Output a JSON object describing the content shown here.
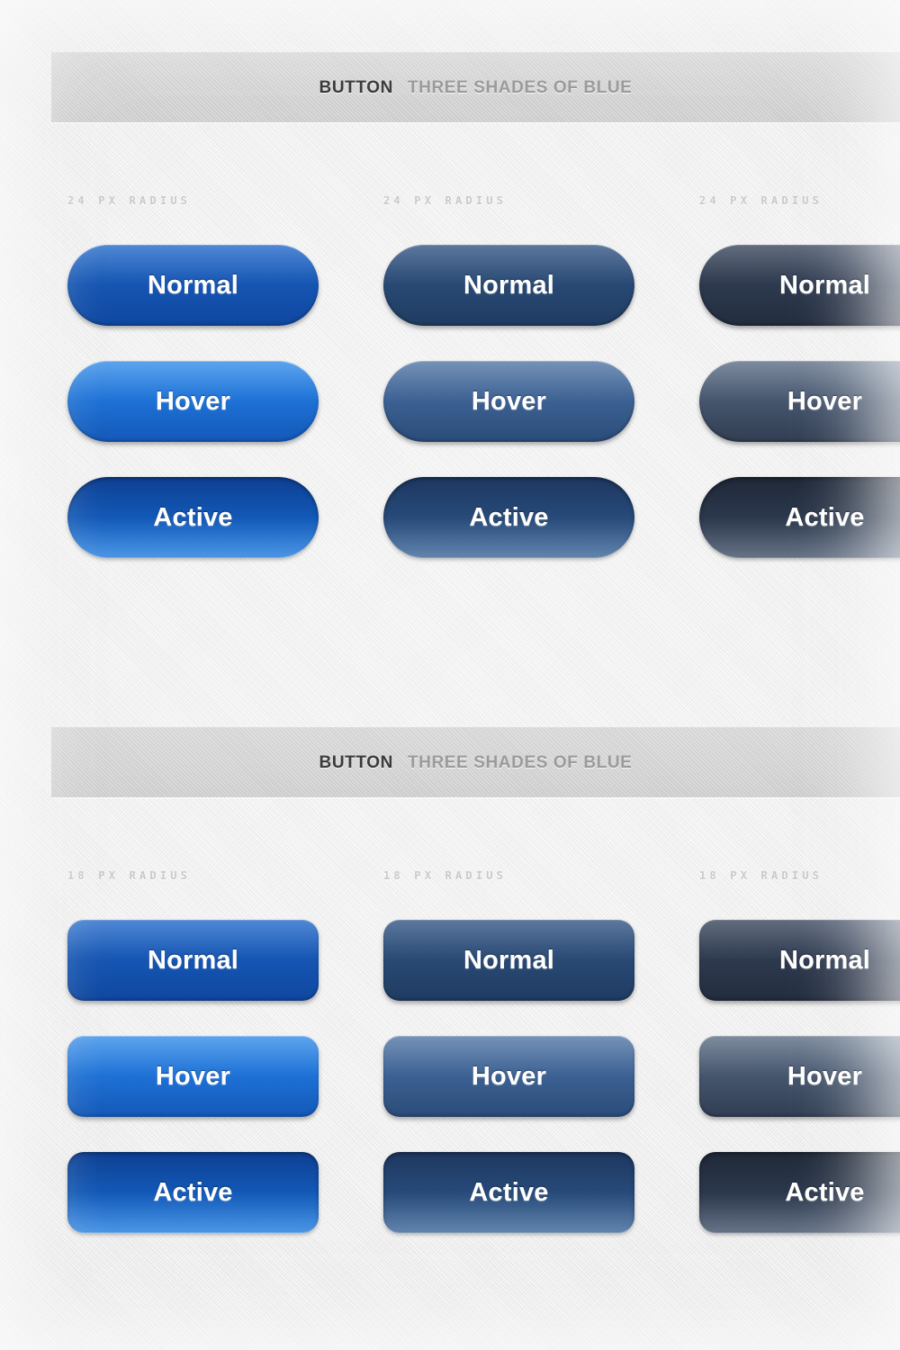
{
  "page": {
    "background_color": "#eeefef",
    "texture": "diagonal-canvas-weave"
  },
  "sections": [
    {
      "id": "section-1",
      "header": {
        "strong": "BUTTON",
        "light": "THREE SHADES OF BLUE"
      },
      "radius_label": "24 PX RADIUS",
      "radius_px": 24,
      "columns": [
        {
          "shade": "vivid-blue",
          "accent": "#1657b5",
          "buttons": [
            {
              "state": "normal",
              "label": "Normal"
            },
            {
              "state": "hover",
              "label": "Hover"
            },
            {
              "state": "active",
              "label": "Active"
            }
          ]
        },
        {
          "shade": "steel-blue",
          "accent": "#294a75",
          "buttons": [
            {
              "state": "normal",
              "label": "Normal"
            },
            {
              "state": "hover",
              "label": "Hover"
            },
            {
              "state": "active",
              "label": "Active"
            }
          ]
        },
        {
          "shade": "slate-navy",
          "accent": "#2e3a4f",
          "buttons": [
            {
              "state": "normal",
              "label": "Normal"
            },
            {
              "state": "hover",
              "label": "Hover"
            },
            {
              "state": "active",
              "label": "Active"
            }
          ]
        }
      ]
    },
    {
      "id": "section-2",
      "header": {
        "strong": "BUTTON",
        "light": "THREE SHADES OF BLUE"
      },
      "radius_label": "18 PX RADIUS",
      "radius_px": 18,
      "columns": [
        {
          "shade": "vivid-blue",
          "accent": "#1657b5",
          "buttons": [
            {
              "state": "normal",
              "label": "Normal"
            },
            {
              "state": "hover",
              "label": "Hover"
            },
            {
              "state": "active",
              "label": "Active"
            }
          ]
        },
        {
          "shade": "steel-blue",
          "accent": "#294a75",
          "buttons": [
            {
              "state": "normal",
              "label": "Normal"
            },
            {
              "state": "hover",
              "label": "Hover"
            },
            {
              "state": "active",
              "label": "Active"
            }
          ]
        },
        {
          "shade": "slate-navy",
          "accent": "#2e3a4f",
          "buttons": [
            {
              "state": "normal",
              "label": "Normal"
            },
            {
              "state": "hover",
              "label": "Hover"
            },
            {
              "state": "active",
              "label": "Active"
            }
          ]
        }
      ]
    }
  ]
}
